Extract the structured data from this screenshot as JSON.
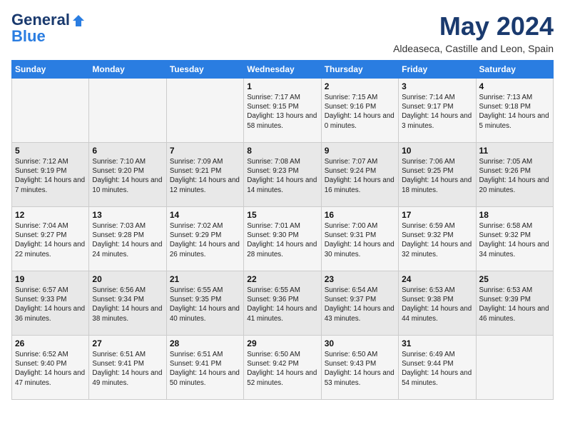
{
  "logo": {
    "line1": "General",
    "line2": "Blue"
  },
  "title": "May 2024",
  "location": "Aldeaseca, Castille and Leon, Spain",
  "weekdays": [
    "Sunday",
    "Monday",
    "Tuesday",
    "Wednesday",
    "Thursday",
    "Friday",
    "Saturday"
  ],
  "weeks": [
    [
      {
        "day": "",
        "info": ""
      },
      {
        "day": "",
        "info": ""
      },
      {
        "day": "",
        "info": ""
      },
      {
        "day": "1",
        "info": "Sunrise: 7:17 AM\nSunset: 9:15 PM\nDaylight: 13 hours and 58 minutes."
      },
      {
        "day": "2",
        "info": "Sunrise: 7:15 AM\nSunset: 9:16 PM\nDaylight: 14 hours and 0 minutes."
      },
      {
        "day": "3",
        "info": "Sunrise: 7:14 AM\nSunset: 9:17 PM\nDaylight: 14 hours and 3 minutes."
      },
      {
        "day": "4",
        "info": "Sunrise: 7:13 AM\nSunset: 9:18 PM\nDaylight: 14 hours and 5 minutes."
      }
    ],
    [
      {
        "day": "5",
        "info": "Sunrise: 7:12 AM\nSunset: 9:19 PM\nDaylight: 14 hours and 7 minutes."
      },
      {
        "day": "6",
        "info": "Sunrise: 7:10 AM\nSunset: 9:20 PM\nDaylight: 14 hours and 10 minutes."
      },
      {
        "day": "7",
        "info": "Sunrise: 7:09 AM\nSunset: 9:21 PM\nDaylight: 14 hours and 12 minutes."
      },
      {
        "day": "8",
        "info": "Sunrise: 7:08 AM\nSunset: 9:23 PM\nDaylight: 14 hours and 14 minutes."
      },
      {
        "day": "9",
        "info": "Sunrise: 7:07 AM\nSunset: 9:24 PM\nDaylight: 14 hours and 16 minutes."
      },
      {
        "day": "10",
        "info": "Sunrise: 7:06 AM\nSunset: 9:25 PM\nDaylight: 14 hours and 18 minutes."
      },
      {
        "day": "11",
        "info": "Sunrise: 7:05 AM\nSunset: 9:26 PM\nDaylight: 14 hours and 20 minutes."
      }
    ],
    [
      {
        "day": "12",
        "info": "Sunrise: 7:04 AM\nSunset: 9:27 PM\nDaylight: 14 hours and 22 minutes."
      },
      {
        "day": "13",
        "info": "Sunrise: 7:03 AM\nSunset: 9:28 PM\nDaylight: 14 hours and 24 minutes."
      },
      {
        "day": "14",
        "info": "Sunrise: 7:02 AM\nSunset: 9:29 PM\nDaylight: 14 hours and 26 minutes."
      },
      {
        "day": "15",
        "info": "Sunrise: 7:01 AM\nSunset: 9:30 PM\nDaylight: 14 hours and 28 minutes."
      },
      {
        "day": "16",
        "info": "Sunrise: 7:00 AM\nSunset: 9:31 PM\nDaylight: 14 hours and 30 minutes."
      },
      {
        "day": "17",
        "info": "Sunrise: 6:59 AM\nSunset: 9:32 PM\nDaylight: 14 hours and 32 minutes."
      },
      {
        "day": "18",
        "info": "Sunrise: 6:58 AM\nSunset: 9:32 PM\nDaylight: 14 hours and 34 minutes."
      }
    ],
    [
      {
        "day": "19",
        "info": "Sunrise: 6:57 AM\nSunset: 9:33 PM\nDaylight: 14 hours and 36 minutes."
      },
      {
        "day": "20",
        "info": "Sunrise: 6:56 AM\nSunset: 9:34 PM\nDaylight: 14 hours and 38 minutes."
      },
      {
        "day": "21",
        "info": "Sunrise: 6:55 AM\nSunset: 9:35 PM\nDaylight: 14 hours and 40 minutes."
      },
      {
        "day": "22",
        "info": "Sunrise: 6:55 AM\nSunset: 9:36 PM\nDaylight: 14 hours and 41 minutes."
      },
      {
        "day": "23",
        "info": "Sunrise: 6:54 AM\nSunset: 9:37 PM\nDaylight: 14 hours and 43 minutes."
      },
      {
        "day": "24",
        "info": "Sunrise: 6:53 AM\nSunset: 9:38 PM\nDaylight: 14 hours and 44 minutes."
      },
      {
        "day": "25",
        "info": "Sunrise: 6:53 AM\nSunset: 9:39 PM\nDaylight: 14 hours and 46 minutes."
      }
    ],
    [
      {
        "day": "26",
        "info": "Sunrise: 6:52 AM\nSunset: 9:40 PM\nDaylight: 14 hours and 47 minutes."
      },
      {
        "day": "27",
        "info": "Sunrise: 6:51 AM\nSunset: 9:41 PM\nDaylight: 14 hours and 49 minutes."
      },
      {
        "day": "28",
        "info": "Sunrise: 6:51 AM\nSunset: 9:41 PM\nDaylight: 14 hours and 50 minutes."
      },
      {
        "day": "29",
        "info": "Sunrise: 6:50 AM\nSunset: 9:42 PM\nDaylight: 14 hours and 52 minutes."
      },
      {
        "day": "30",
        "info": "Sunrise: 6:50 AM\nSunset: 9:43 PM\nDaylight: 14 hours and 53 minutes."
      },
      {
        "day": "31",
        "info": "Sunrise: 6:49 AM\nSunset: 9:44 PM\nDaylight: 14 hours and 54 minutes."
      },
      {
        "day": "",
        "info": ""
      }
    ]
  ]
}
